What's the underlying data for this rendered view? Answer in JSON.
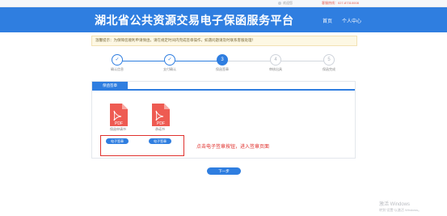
{
  "top_bar": {
    "user": "欢迎您",
    "hotline": "客服热线：027-87310008"
  },
  "header": {
    "title": "湖北省公共资源交易电子保函服务平台",
    "nav": [
      "首页",
      "个人中心"
    ]
  },
  "notice": {
    "text": "温馨提示：为保障您顺利申请保函，请在规定时间内完成签章操作，如遇问题请及时联系客服处理！"
  },
  "steps": [
    {
      "num": "✓",
      "label": "确认信息",
      "state": "done"
    },
    {
      "num": "✓",
      "label": "支付确认",
      "state": "done"
    },
    {
      "num": "3",
      "label": "保函签章",
      "state": "active"
    },
    {
      "num": "4",
      "label": "审核出具",
      "state": "todo"
    },
    {
      "num": "5",
      "label": "保函完成",
      "state": "todo"
    }
  ],
  "panel": {
    "tab_label": "保函签章",
    "documents": [
      {
        "name": "保函申请书",
        "button": "电子签章"
      },
      {
        "name": "承诺书",
        "button": "电子签章"
      }
    ]
  },
  "annotation": {
    "hint": "点击电子签章按钮，进入签章页面"
  },
  "next_button": "下一步",
  "watermark": {
    "line1": "激活 Windows",
    "line2": "转到\"设置\"以激活 Windows。"
  },
  "colors": {
    "primary": "#2f7ee0",
    "pdf_red": "#ee5b52",
    "annotation_red": "#e0322e"
  }
}
